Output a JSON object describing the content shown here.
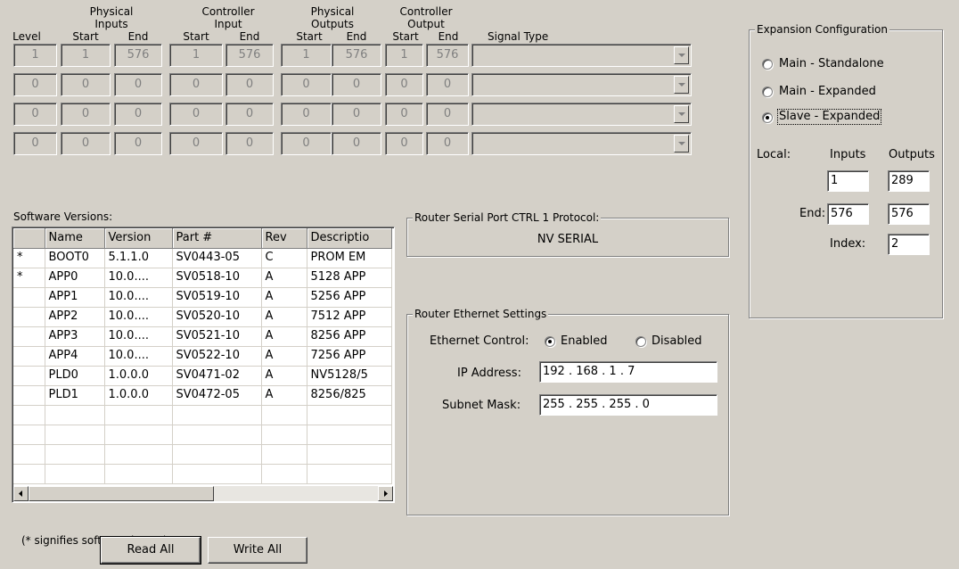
{
  "headers": {
    "level": "Level",
    "physical_inputs": [
      "Physical",
      "Inputs"
    ],
    "controller_input": [
      "Controller",
      "Input"
    ],
    "physical_outputs": [
      "Physical",
      "Outputs"
    ],
    "controller_output": [
      "Controller",
      "Output"
    ],
    "start": "Start",
    "end": "End",
    "signal_type": "Signal Type"
  },
  "level_rows": [
    [
      "1",
      "1",
      "576",
      "1",
      "576",
      "1",
      "576",
      "1",
      "576"
    ],
    [
      "0",
      "0",
      "0",
      "0",
      "0",
      "0",
      "0",
      "0",
      "0"
    ],
    [
      "0",
      "0",
      "0",
      "0",
      "0",
      "0",
      "0",
      "0",
      "0"
    ],
    [
      "0",
      "0",
      "0",
      "0",
      "0",
      "0",
      "0",
      "0",
      "0"
    ]
  ],
  "software": {
    "label": "Software Versions:",
    "columns": [
      "",
      "Name",
      "Version",
      "Part #",
      "Rev",
      "Descriptio"
    ],
    "rows": [
      [
        "*",
        "BOOT0",
        "5.1.1.0",
        "SV0443-05",
        "C",
        "PROM EM"
      ],
      [
        "*",
        "APP0",
        "10.0....",
        "SV0518-10",
        "A",
        "5128 APP"
      ],
      [
        "",
        "APP1",
        "10.0....",
        "SV0519-10",
        "A",
        "5256 APP"
      ],
      [
        "",
        "APP2",
        "10.0....",
        "SV0520-10",
        "A",
        "7512 APP"
      ],
      [
        "",
        "APP3",
        "10.0....",
        "SV0521-10",
        "A",
        "8256 APP"
      ],
      [
        "",
        "APP4",
        "10.0....",
        "SV0522-10",
        "A",
        "7256 APP"
      ],
      [
        "",
        "PLD0",
        "1.0.0.0",
        "SV0471-02",
        "A",
        "NV5128/5"
      ],
      [
        "",
        "PLD1",
        "1.0.0.0",
        "SV0472-05",
        "A",
        "8256/825"
      ]
    ],
    "note": "(* signifies software in use)"
  },
  "buttons": {
    "read_all": "Read All",
    "write_all": "Write All"
  },
  "serial": {
    "title": "Router Serial Port CTRL 1 Protocol:",
    "value": "NV SERIAL"
  },
  "ethernet": {
    "title": "Router Ethernet Settings",
    "control_label": "Ethernet Control:",
    "enabled": "Enabled",
    "disabled": "Disabled",
    "ip_label": "IP Address:",
    "ip": "192  .  168  .   1   .   7",
    "mask_label": "Subnet Mask:",
    "mask": "255  .  255  .  255  .   0"
  },
  "expansion": {
    "title": "Expansion Configuration",
    "options": [
      "Main  - Standalone",
      "Main  - Expanded",
      "Slave - Expanded"
    ],
    "local_label": "Local:",
    "inputs_label": "Inputs",
    "outputs_label": "Outputs",
    "end_label": "End:",
    "index_label": "Index:",
    "local_inputs": "1",
    "local_outputs": "289",
    "end_inputs": "576",
    "end_outputs": "576",
    "index": "2"
  }
}
